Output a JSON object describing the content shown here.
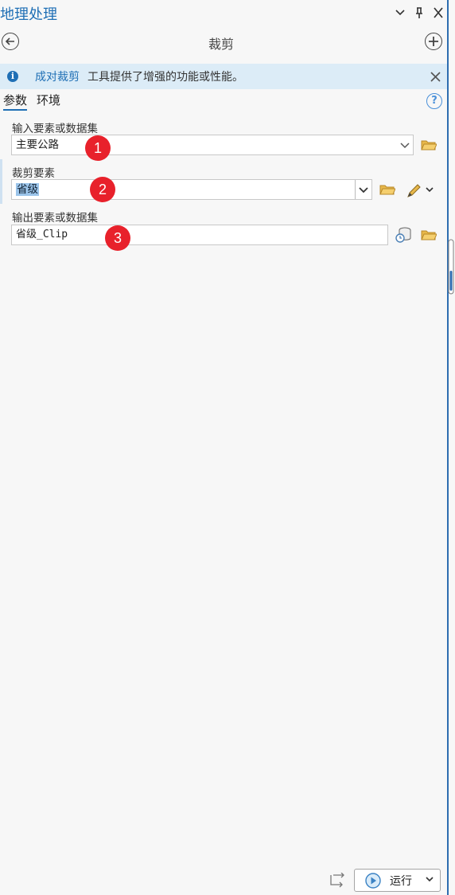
{
  "pane": {
    "title": "地理处理"
  },
  "header": {
    "tool_title": "裁剪"
  },
  "info": {
    "link": "成对裁剪",
    "message": "工具提供了增强的功能或性能。"
  },
  "tabs": [
    {
      "label": "参数"
    },
    {
      "label": "环境"
    }
  ],
  "params": {
    "input": {
      "label": "输入要素或数据集",
      "value": "主要公路"
    },
    "clip": {
      "label": "裁剪要素",
      "value": "省级"
    },
    "output": {
      "label": "输出要素或数据集",
      "value": "省级_Clip"
    }
  },
  "badges": [
    "1",
    "2",
    "3"
  ],
  "footer": {
    "run_label": "运行"
  },
  "colors": {
    "accent": "#1f6fb5",
    "badge": "#e8212b",
    "info_bg": "#dcecf7",
    "folder": "#e8b84a"
  }
}
